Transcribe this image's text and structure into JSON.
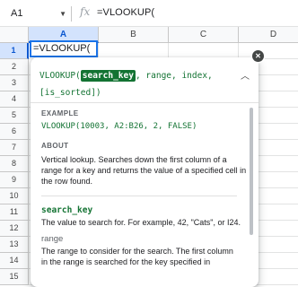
{
  "formula_bar": {
    "cell_ref": "A1",
    "fx_label": "fx",
    "formula": "=VLOOKUP("
  },
  "grid": {
    "columns": [
      "A",
      "B",
      "C",
      "D"
    ],
    "rows": [
      "1",
      "2",
      "3",
      "4",
      "5",
      "6",
      "7",
      "8",
      "9",
      "10",
      "11",
      "12",
      "13",
      "14",
      "15"
    ],
    "active_cell_value": "=VLOOKUP("
  },
  "help": {
    "fn_name": "VLOOKUP(",
    "highlighted_arg": "search_key",
    "rest_line1": ", range, index,",
    "line2": "[is_sorted])",
    "example_label": "EXAMPLE",
    "example": "VLOOKUP(10003, A2:B26, 2, FALSE)",
    "about_label": "ABOUT",
    "about": "Vertical lookup. Searches down the first column of a range for a key and returns the value of a specified cell in the row found.",
    "args": [
      {
        "name": "search_key",
        "desc": "The value to search for. For example, 42, \"Cats\", or I24."
      },
      {
        "name": "range",
        "desc": "The range to consider for the search. The first column in the range is searched for the key specified in"
      }
    ]
  },
  "colors": {
    "accent": "#1a73e8",
    "syntax_green": "#137333"
  }
}
